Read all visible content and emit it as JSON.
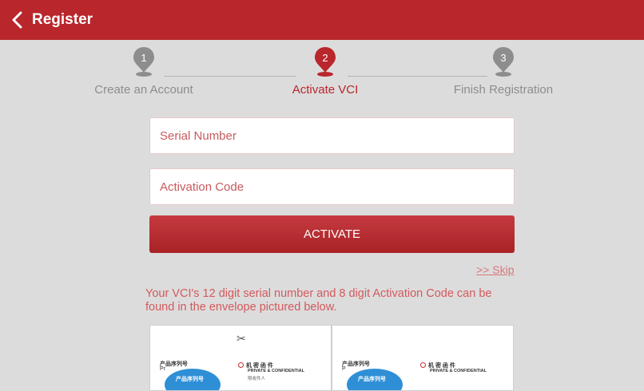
{
  "header": {
    "title": "Register",
    "back_icon": "chevron-left-icon"
  },
  "steps": [
    {
      "number": "1",
      "label": "Create an Account",
      "state": "inactive"
    },
    {
      "number": "2",
      "label": "Activate VCI",
      "state": "active"
    },
    {
      "number": "3",
      "label": "Finish Registration",
      "state": "inactive"
    }
  ],
  "form": {
    "serial_placeholder": "Serial Number",
    "serial_value": "",
    "activation_placeholder": "Activation Code",
    "activation_value": "",
    "activate_label": "ACTIVATE",
    "skip_label": ">> Skip"
  },
  "info": {
    "text": "Your VCI's 12 digit serial number and 8 digit Activation Code can be found in the envelope pictured below."
  },
  "envelopes": [
    {
      "label_cn": "产品序列号",
      "label_pr": "Pr",
      "blob_text": "产品序列号",
      "brand_cn": "机 密 函 件",
      "brand_en": "PRIVATE & CONFIDENTIAL",
      "brand_sub": "限收件人",
      "scissors": "✂"
    },
    {
      "label_cn": "产品序列号",
      "label_pr": "P",
      "blob_text": "产品序列号",
      "brand_cn": "机 密 函 件",
      "brand_en": "PRIVATE & CONFIDENTIAL",
      "brand_sub": "",
      "scissors": ""
    }
  ],
  "colors": {
    "brand_red": "#b9262c",
    "inactive_grey": "#8d8d8d",
    "background": "#dddcdc"
  }
}
